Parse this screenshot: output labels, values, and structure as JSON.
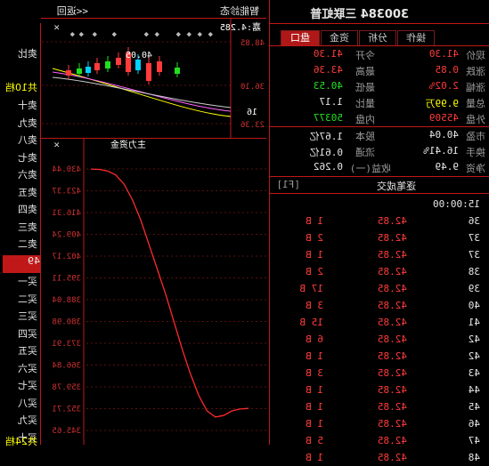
{
  "header": {
    "title": "300384 三联虹普",
    "back_label": "<<返回",
    "tab_right": "智能診态",
    "right_label": "嘉:4.285"
  },
  "tabs": [
    "盘口",
    "资金",
    "分析",
    "操作"
  ],
  "quote_left": [
    {
      "label": "现价",
      "value": "41.30"
    },
    {
      "label": "涨跌",
      "value": "0.85"
    },
    {
      "label": "涨幅",
      "value": "2.02%"
    },
    {
      "label": "总量",
      "value": "9.99万"
    },
    {
      "label": "外盘",
      "value": "45509"
    }
  ],
  "quote_right": [
    {
      "label": "今开",
      "value": "41.30"
    },
    {
      "label": "最高",
      "value": "43.36"
    },
    {
      "label": "最低",
      "value": "40.53"
    },
    {
      "label": "量比",
      "value": "1.17"
    },
    {
      "label": "内盘",
      "value": "50377"
    }
  ],
  "quote2_left": [
    {
      "label": "市盈",
      "value": "40.04"
    },
    {
      "label": "换手",
      "value": "16.41%"
    },
    {
      "label": "净资",
      "value": "9.49"
    }
  ],
  "quote2_right": [
    {
      "label": "股本",
      "value": "1.67亿"
    },
    {
      "label": "流通",
      "value": "0.61亿"
    },
    {
      "label": "收益(一)",
      "value": "0.262"
    }
  ],
  "trades_header": "逐笔成交",
  "trades_right_label": "[F1]",
  "trades": [
    {
      "time": "15:00:00",
      "price": "",
      "vol": ""
    },
    {
      "time": "36",
      "price": "42.85",
      "vol": "1 B"
    },
    {
      "time": "37",
      "price": "42.85",
      "vol": "2 B"
    },
    {
      "time": "37",
      "price": "42.85",
      "vol": "1 B"
    },
    {
      "time": "38",
      "price": "42.85",
      "vol": "2 B"
    },
    {
      "time": "39",
      "price": "42.85",
      "vol": "17 B"
    },
    {
      "time": "40",
      "price": "42.85",
      "vol": "3 B"
    },
    {
      "time": "41",
      "price": "42.85",
      "vol": "15 B"
    },
    {
      "time": "42",
      "price": "42.85",
      "vol": "6 B"
    },
    {
      "time": "42",
      "price": "42.85",
      "vol": "1 B"
    },
    {
      "time": "43",
      "price": "42.85",
      "vol": "3 B"
    },
    {
      "time": "44",
      "price": "42.85",
      "vol": "1 B"
    },
    {
      "time": "45",
      "price": "42.85",
      "vol": "1 B"
    },
    {
      "time": "46",
      "price": "42.85",
      "vol": "1 B"
    },
    {
      "time": "47",
      "price": "42.85",
      "vol": "5 B"
    },
    {
      "time": "48",
      "price": "42.85",
      "vol": "1 B"
    }
  ],
  "order_book": [
    "卖十",
    "卖九",
    "卖八",
    "卖七",
    "卖六",
    "卖五",
    "卖四",
    "卖三",
    "卖二",
    "卖一",
    "买一",
    "买二",
    "买三",
    "买四",
    "买五",
    "买六",
    "买七",
    "买八",
    "买九",
    "买十"
  ],
  "order_top": [
    "卖比",
    "共10档"
  ],
  "order_bottom": "共24档",
  "order_highlight": "49",
  "kline": {
    "labels": [
      "48.85",
      "36.10",
      "23.36"
    ],
    "annot": "40.05",
    "annot2": "16"
  },
  "line_chart": {
    "title": "主力资金",
    "axis": [
      "430.44",
      "423.37",
      "416.31",
      "409.24",
      "402.17",
      "395.11",
      "388.04",
      "380.98",
      "373.91",
      "366.84",
      "359.78",
      "352.71",
      "345.65",
      "338.58"
    ],
    "values": [
      430.4,
      430.3,
      429.8,
      428.5,
      425.5,
      420.5,
      414,
      406,
      398,
      390,
      381,
      372,
      364,
      357,
      352,
      350,
      350.5,
      352,
      352.6,
      352.8
    ]
  },
  "colors": {
    "bg": "#000000",
    "grid": "#c01818",
    "up": "#ff3b3b",
    "down": "#20e020"
  }
}
